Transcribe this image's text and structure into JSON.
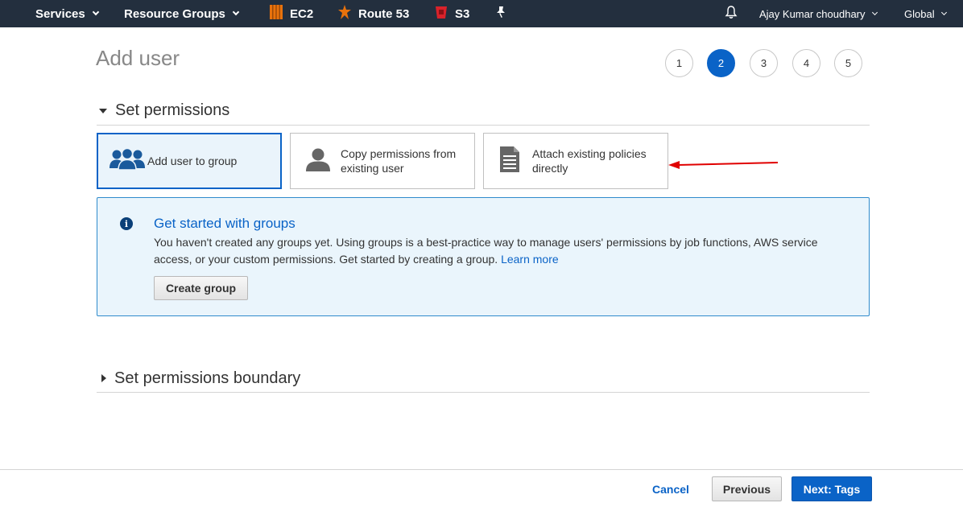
{
  "nav": {
    "services": "Services",
    "resource_groups": "Resource Groups",
    "ec2": "EC2",
    "route53": "Route 53",
    "s3": "S3",
    "user": "Ajay Kumar choudhary",
    "region": "Global"
  },
  "page": {
    "title": "Add user"
  },
  "steps": [
    "1",
    "2",
    "3",
    "4",
    "5"
  ],
  "active_step": 2,
  "permissions": {
    "section_title": "Set permissions",
    "options": [
      {
        "label": "Add user to group",
        "icon": "users-group-icon"
      },
      {
        "label": "Copy permissions from existing user",
        "icon": "user-silhouette-icon"
      },
      {
        "label": "Attach existing policies directly",
        "icon": "document-icon"
      }
    ]
  },
  "info": {
    "title": "Get started with groups",
    "body": "You haven't created any groups yet. Using groups is a best-practice way to manage users' permissions by job functions, AWS service access, or your custom permissions. Get started by creating a group.",
    "link": "Learn more",
    "button": "Create group"
  },
  "boundary": {
    "section_title": "Set permissions boundary"
  },
  "footer": {
    "cancel": "Cancel",
    "previous": "Previous",
    "next": "Next: Tags"
  },
  "colors": {
    "nav_bg": "#232f3e",
    "primary": "#0a63c7",
    "info_bg": "#eaf5fc",
    "aws_orange": "#e8720c",
    "annotation_red": "#e00000"
  }
}
